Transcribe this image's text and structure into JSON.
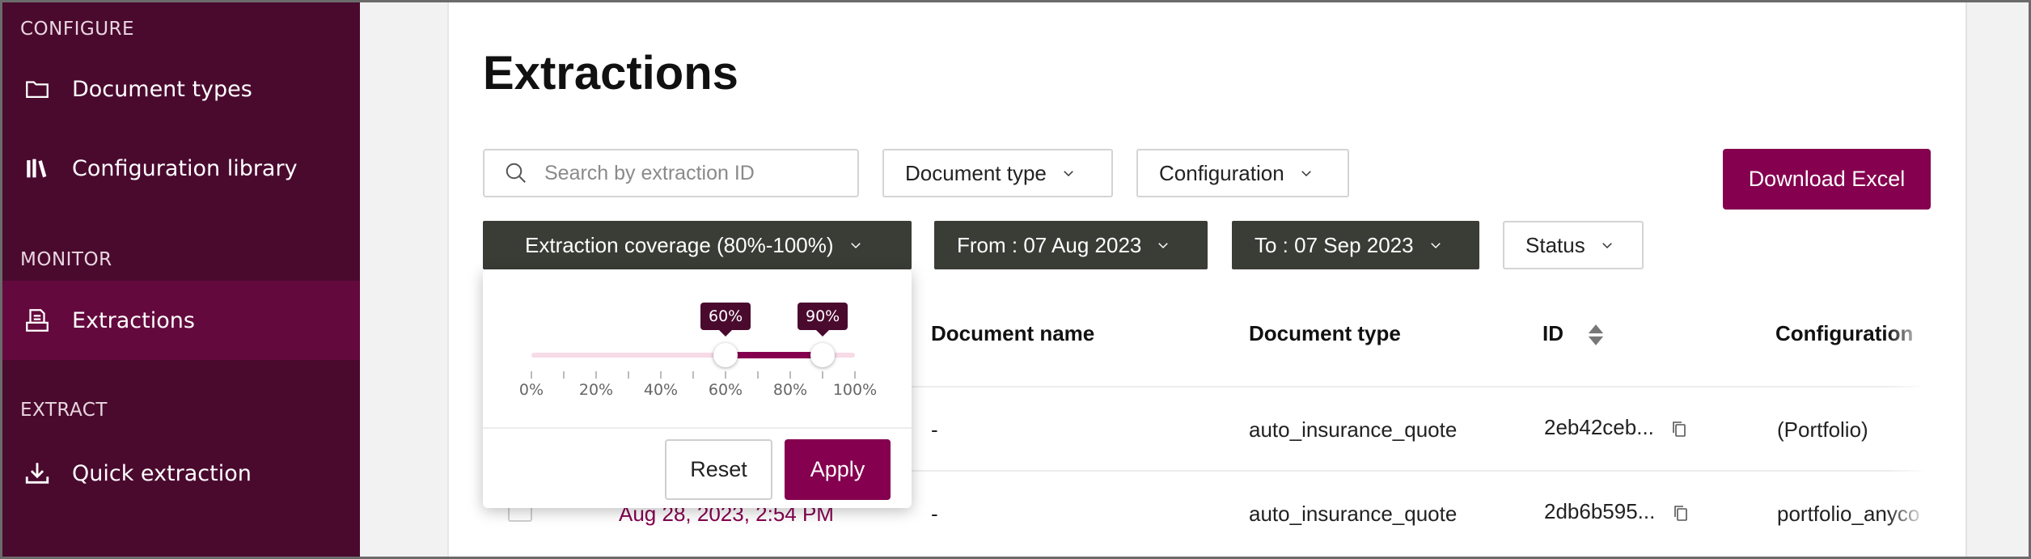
{
  "sidebar": {
    "sections": {
      "configure": "CONFIGURE",
      "monitor": "MONITOR",
      "extract": "EXTRACT"
    },
    "items": [
      {
        "label": "Document types",
        "icon": "folder-icon"
      },
      {
        "label": "Configuration library",
        "icon": "library-icon"
      },
      {
        "label": "Extractions",
        "icon": "extractions-icon",
        "active": true
      },
      {
        "label": "Quick extraction",
        "icon": "download-icon"
      }
    ]
  },
  "page": {
    "title": "Extractions"
  },
  "filters": {
    "search_placeholder": "Search by extraction ID",
    "document_type": "Document type",
    "configuration": "Configuration",
    "coverage": "Extraction coverage (80%-100%)",
    "from": "From : 07 Aug 2023",
    "to": "To : 07 Sep 2023",
    "status": "Status"
  },
  "actions": {
    "download_excel": "Download Excel"
  },
  "table": {
    "columns": {
      "document_name": "Document name",
      "document_type": "Document type",
      "id": "ID",
      "configuration": "Configuration"
    },
    "rows": [
      {
        "document_name": "-",
        "document_type": "auto_insurance_quote",
        "id": "2eb42ceb...",
        "configuration": "(Portfolio)"
      },
      {
        "date": "Aug 28, 2023, 2:54 PM",
        "document_name": "-",
        "document_type": "auto_insurance_quote",
        "id": "2db6b595...",
        "configuration": "portfolio_anyco"
      }
    ]
  },
  "coverage_popover": {
    "min_label": "60%",
    "max_label": "90%",
    "min_value": 60,
    "max_value": 90,
    "ticks": [
      "0%",
      "20%",
      "40%",
      "60%",
      "80%",
      "100%"
    ],
    "reset": "Reset",
    "apply": "Apply"
  },
  "colors": {
    "sidebar_bg": "#4a0a2e",
    "sidebar_active": "#64093d",
    "primary": "#85004f",
    "dark_chip": "#3a3d36"
  }
}
